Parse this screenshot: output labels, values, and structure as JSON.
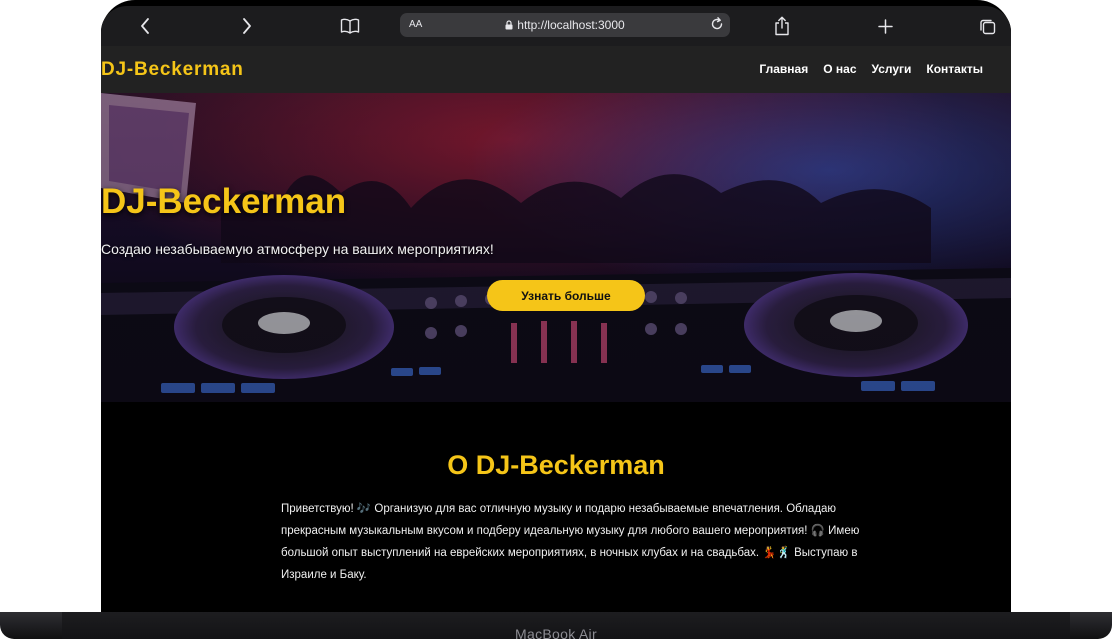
{
  "device": {
    "label": "MacBook Air"
  },
  "browser": {
    "aa_label": "AA",
    "url": "http://localhost:3000"
  },
  "site": {
    "logo": "DJ-Beckerman",
    "menu": [
      "Главная",
      "О нас",
      "Услуги",
      "Контакты"
    ]
  },
  "hero": {
    "title": "DJ-Beckerman",
    "subtitle": "Создаю незабываемую атмосферу на ваших мероприятиях!",
    "button": "Узнать больше"
  },
  "about": {
    "title": "О DJ-Beckerman",
    "text": "Приветствую! 🎶 Организую для вас отличную музыку и подарю незабываемые впечатления. Обладаю прекрасным музыкальным вкусом и подберу идеальную музыку для любого вашего мероприятия! 🎧 Имею большой опыт выступлений на еврейских мероприятиях, в ночных клубах и на свадьбах. 💃🕺 Выступаю в Израиле и Баку."
  },
  "colors": {
    "accent": "#f5c518",
    "nav_bg": "#222222",
    "page_bg": "#000000"
  }
}
